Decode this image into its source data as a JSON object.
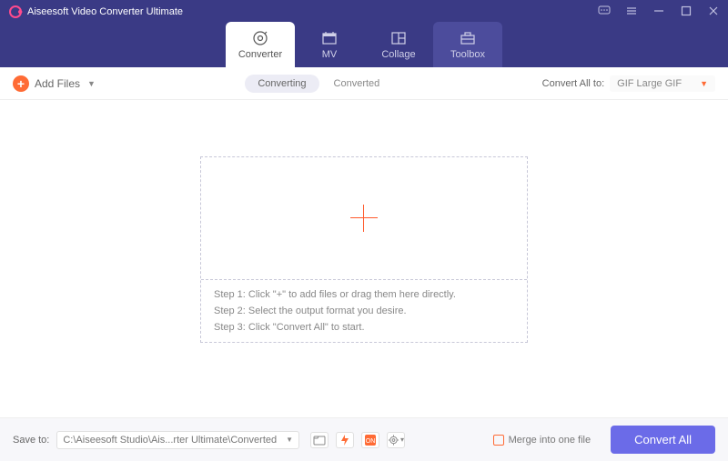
{
  "app": {
    "title": "Aiseesoft Video Converter Ultimate"
  },
  "tabs": {
    "converter": "Converter",
    "mv": "MV",
    "collage": "Collage",
    "toolbox": "Toolbox"
  },
  "toolbar": {
    "add_files": "Add Files",
    "converting": "Converting",
    "converted": "Converted",
    "convert_all_to": "Convert All to:",
    "format": "GIF Large GIF"
  },
  "drop": {
    "step1": "Step 1: Click \"+\" to add files or drag them here directly.",
    "step2": "Step 2: Select the output format you desire.",
    "step3": "Step 3: Click \"Convert All\" to start."
  },
  "footer": {
    "save_to": "Save to:",
    "path": "C:\\Aiseesoft Studio\\Ais...rter Ultimate\\Converted",
    "merge": "Merge into one file",
    "convert_all": "Convert All"
  }
}
